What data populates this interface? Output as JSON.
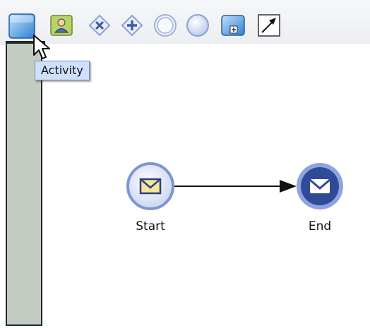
{
  "palette": {
    "tools": [
      {
        "icon": "activity-icon"
      },
      {
        "icon": "user-task-icon"
      },
      {
        "icon": "exclusive-gateway-icon"
      },
      {
        "icon": "parallel-gateway-icon"
      },
      {
        "icon": "intermediate-event-icon"
      },
      {
        "icon": "start-event-icon"
      },
      {
        "icon": "subprocess-icon"
      },
      {
        "icon": "sequence-flow-icon"
      }
    ],
    "tooltip": "Activity"
  },
  "diagram": {
    "start_label": "Start",
    "end_label": "End"
  },
  "colors": {
    "lane": "#c3cbc3",
    "lane_border": "#1f2a2a",
    "tooltip_bg": "#cfe0ff",
    "event_ring": "#7f95cf",
    "end_fill": "#6e86c9",
    "envelope": "#f5e49a"
  }
}
